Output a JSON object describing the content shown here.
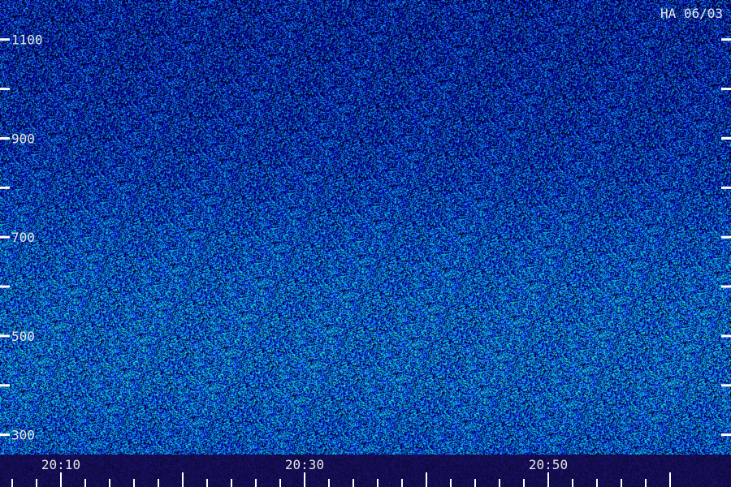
{
  "chart_data": {
    "type": "heatmap",
    "title": "",
    "station_label": "HA 06/03",
    "xlabel": "",
    "ylabel": "",
    "x_tick_labels": [
      "20:10",
      "20:30",
      "20:50"
    ],
    "x_ticks": [
      {
        "value": "20:06",
        "major": false
      },
      {
        "value": "20:08",
        "major": false
      },
      {
        "value": "20:10",
        "major": true
      },
      {
        "value": "20:12",
        "major": false
      },
      {
        "value": "20:14",
        "major": false
      },
      {
        "value": "20:16",
        "major": false
      },
      {
        "value": "20:18",
        "major": false
      },
      {
        "value": "20:20",
        "major": true
      },
      {
        "value": "20:22",
        "major": false
      },
      {
        "value": "20:24",
        "major": false
      },
      {
        "value": "20:26",
        "major": false
      },
      {
        "value": "20:28",
        "major": false
      },
      {
        "value": "20:30",
        "major": true
      },
      {
        "value": "20:32",
        "major": false
      },
      {
        "value": "20:34",
        "major": false
      },
      {
        "value": "20:36",
        "major": false
      },
      {
        "value": "20:38",
        "major": false
      },
      {
        "value": "20:40",
        "major": true
      },
      {
        "value": "20:42",
        "major": false
      },
      {
        "value": "20:44",
        "major": false
      },
      {
        "value": "20:46",
        "major": false
      },
      {
        "value": "20:48",
        "major": false
      },
      {
        "value": "20:50",
        "major": true
      },
      {
        "value": "20:52",
        "major": false
      },
      {
        "value": "20:54",
        "major": false
      },
      {
        "value": "20:56",
        "major": false
      },
      {
        "value": "20:58",
        "major": false
      },
      {
        "value": "21:00",
        "major": true
      }
    ],
    "x_range": [
      "20:05",
      "21:05"
    ],
    "y_tick_labels": [
      "1100",
      "900",
      "700",
      "500",
      "300"
    ],
    "y_ticks": [
      1100,
      1000,
      900,
      800,
      700,
      600,
      500,
      400,
      300
    ],
    "y_range": [
      260,
      1180
    ],
    "intensity_profile": [
      {
        "y": 1150,
        "level": 0.34
      },
      {
        "y": 1100,
        "level": 0.34
      },
      {
        "y": 1000,
        "level": 0.36
      },
      {
        "y": 900,
        "level": 0.38
      },
      {
        "y": 800,
        "level": 0.42
      },
      {
        "y": 700,
        "level": 0.48
      },
      {
        "y": 600,
        "level": 0.52
      },
      {
        "y": 500,
        "level": 0.54
      },
      {
        "y": 400,
        "level": 0.54
      },
      {
        "y": 300,
        "level": 0.5
      }
    ],
    "colormap": [
      "#000010",
      "#00005a",
      "#0000c8",
      "#2850ff",
      "#00b4e6",
      "#00e6b4",
      "#a0ff50"
    ],
    "tick_color": "#ffffff",
    "label_color": "#e8e8e8",
    "grid": false
  }
}
